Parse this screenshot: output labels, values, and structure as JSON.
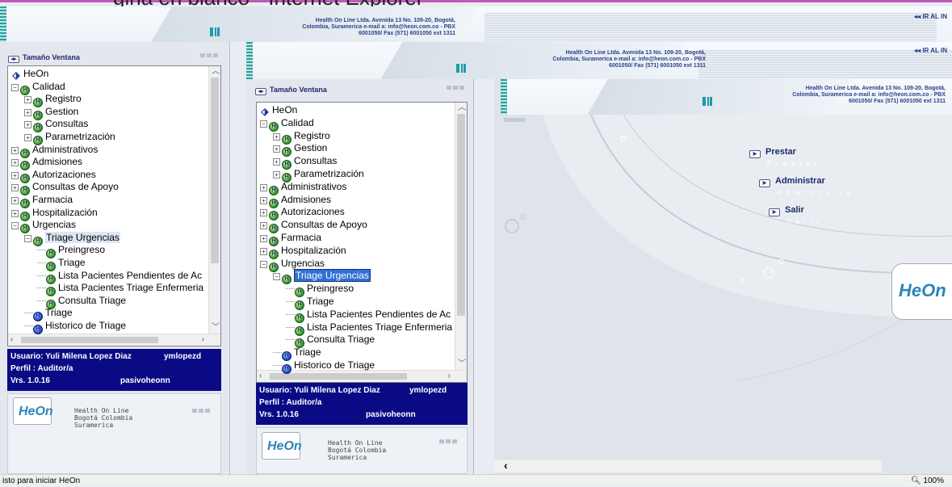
{
  "top_title": "gina en blanco - Internet Explorer",
  "banner": {
    "info_line1": "Health On Line Ltda. Avenida 13 No. 109-20, Bogotá,",
    "info_line2": "Colombia, Suramerica e-mail a: info@heon.com.co - PBX",
    "info_line3": "6001050/ Fax (571) 6001050 ext 1311",
    "ir_label": "◂◂ IR AL IN"
  },
  "panel": {
    "title": "Tamaño Ventana",
    "tree_root": "HeOn",
    "tree": [
      {
        "label": "Calidad",
        "level": 1,
        "pm": "−"
      },
      {
        "label": "Registro",
        "level": 2,
        "pm": "+"
      },
      {
        "label": "Gestion",
        "level": 2,
        "pm": "+"
      },
      {
        "label": "Consultas",
        "level": 2,
        "pm": "+"
      },
      {
        "label": "Parametrización",
        "level": 2,
        "pm": "+"
      },
      {
        "label": "Administrativos",
        "level": 1,
        "pm": "+"
      },
      {
        "label": "Admisiones",
        "level": 1,
        "pm": "+"
      },
      {
        "label": "Autorizaciones",
        "level": 1,
        "pm": "+"
      },
      {
        "label": "Consultas de Apoyo",
        "level": 1,
        "pm": "+"
      },
      {
        "label": "Farmacia",
        "level": 1,
        "pm": "+"
      },
      {
        "label": "Hospitalización",
        "level": 1,
        "pm": "+"
      },
      {
        "label": "Urgencias",
        "level": 1,
        "pm": "−"
      },
      {
        "label": "Triage Urgencias",
        "level": 2,
        "pm": "−"
      },
      {
        "label": "Preingreso",
        "level": 3,
        "pm": ""
      },
      {
        "label": "Triage",
        "level": 3,
        "pm": ""
      },
      {
        "label": "Lista Pacientes Pendientes de Ac",
        "level": 3,
        "pm": ""
      },
      {
        "label": "Lista Pacientes Triage Enfermeria",
        "level": 3,
        "pm": ""
      },
      {
        "label": "Consulta Triage",
        "level": 3,
        "pm": ""
      },
      {
        "label": "Triage",
        "level": 2,
        "pm": "",
        "blue": true
      },
      {
        "label": "Historico de Triage",
        "level": 2,
        "pm": "",
        "blue": true
      }
    ],
    "user_label": "Usuario: Yuli Milena Lopez Diaz",
    "user_login": "ymlopezd",
    "profile_label": "Perfil  : Auditor/a",
    "version_label": "Vrs. 1.0.16",
    "server_label": "pasivoheonn",
    "footer_line1": "Health On Line",
    "footer_line2a": "Bogotá Colombia",
    "footer_line2b": "Bogotá Colombia",
    "footer_line3": "Suramerica",
    "footer_logo": "HeOn"
  },
  "main_menu": [
    {
      "label": "Prestar",
      "sub": "Prestar"
    },
    {
      "label": "Administrar",
      "sub": "Administrar"
    },
    {
      "label": "Salir",
      "sub": "Salir"
    }
  ],
  "main_logo": "HeOn",
  "status": {
    "text": "isto para iniciar HeOn",
    "zoom": "100%"
  },
  "colors": {
    "user_bg": "#0a0a85",
    "selected": "#2f6fd6",
    "accent": "#1a9ca8"
  },
  "icons": [
    "window-size-icon",
    "heon-root-icon",
    "module-icon",
    "expand-icon",
    "collapse-icon",
    "zoom-icon",
    "scroll-left-icon"
  ]
}
